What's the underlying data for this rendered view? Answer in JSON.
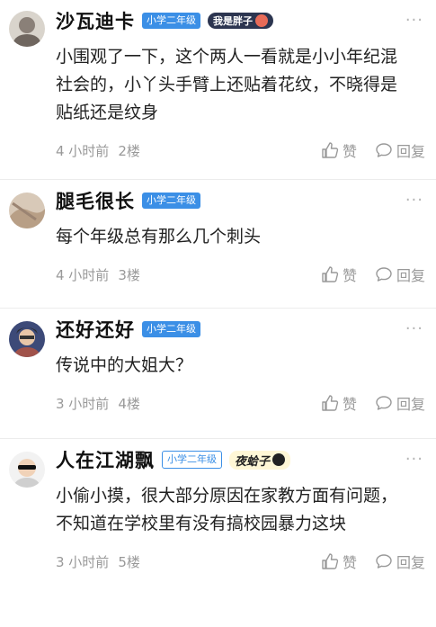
{
  "ui": {
    "like_label": "赞",
    "reply_label": "回复",
    "more_glyph": "···"
  },
  "comments": [
    {
      "username": "沙瓦迪卡",
      "grade_badge": "小学二年级",
      "medal_text": "我是胖子",
      "content": "小围观了一下，这个两人一看就是小小年纪混社会的，小丫头手臂上还贴着花纹，不晓得是贴纸还是纹身",
      "time": "4 小时前",
      "floor": "2楼"
    },
    {
      "username": "腿毛很长",
      "grade_badge": "小学二年级",
      "content": "每个年级总有那么几个刺头",
      "time": "4 小时前",
      "floor": "3楼"
    },
    {
      "username": "还好还好",
      "grade_badge": "小学二年级",
      "content": "传说中的大姐大？",
      "time": "3 小时前",
      "floor": "4楼"
    },
    {
      "username": "人在江湖飘",
      "grade_badge": "小学二年级",
      "medal_text": "夜蛤子",
      "content": "小偷小摸，很大部分原因在家教方面有问题，不知道在学校里有没有搞校园暴力这块",
      "time": "3 小时前",
      "floor": "5楼"
    }
  ]
}
